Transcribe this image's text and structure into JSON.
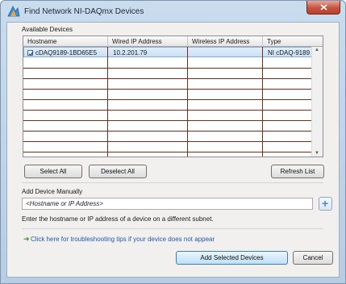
{
  "window": {
    "title": "Find Network NI-DAQmx Devices",
    "close_icon": "close-icon"
  },
  "available": {
    "group_label": "Available Devices",
    "columns": [
      "Hostname",
      "Wired IP Address",
      "Wireless IP Address",
      "Type"
    ],
    "rows": [
      {
        "hostname": "cDAQ9189-1BD65E5",
        "wired_ip": "10.2.201.79",
        "wireless_ip": "",
        "type": "NI cDAQ-9189",
        "checked": true
      }
    ]
  },
  "buttons": {
    "select_all": "Select All",
    "deselect_all": "Deselect All",
    "refresh": "Refresh List",
    "add_selected": "Add Selected Devices",
    "cancel": "Cancel"
  },
  "manual": {
    "label": "Add Device Manually",
    "placeholder": "<Hostname or IP Address>",
    "hint": "Enter the hostname or IP address of a device on a different subnet.",
    "add_icon": "plus-icon"
  },
  "troubleshoot_link": "Click here for troubleshooting tips if your device does not appear",
  "colors": {
    "accent": "#3c7fb1",
    "link": "#1f5aa6",
    "selection": "#cadff5",
    "grid_lines": "#7a2a1a"
  }
}
